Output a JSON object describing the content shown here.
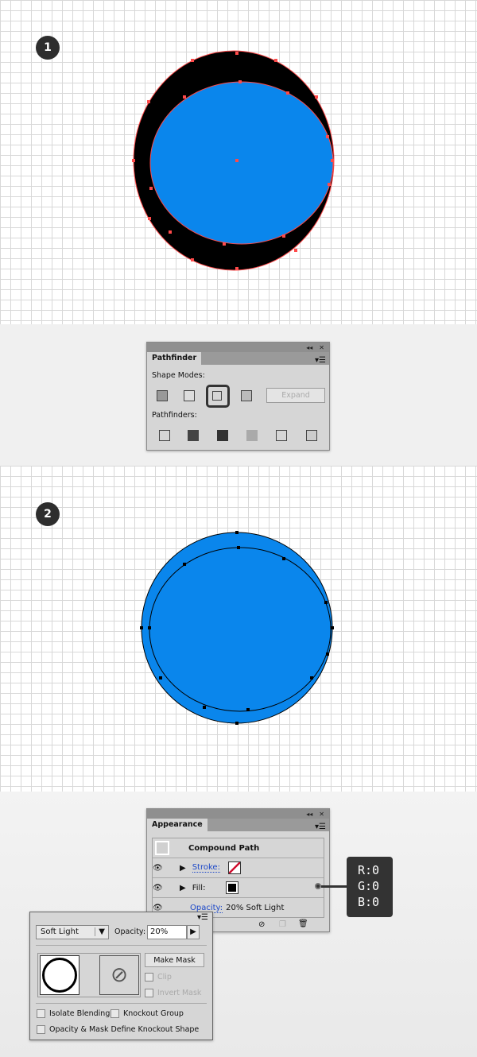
{
  "steps": [
    "1",
    "2"
  ],
  "colors": {
    "fill_blue": "#0a86ec",
    "anchor_red": "#ff4a4a",
    "panel_bg": "#d6d6d6"
  },
  "pathfinder": {
    "title": "Pathfinder",
    "shape_modes_label": "Shape Modes:",
    "expand_label": "Expand",
    "pathfinders_label": "Pathfinders:",
    "shape_mode_icons": [
      "unite-icon",
      "minus-front-icon",
      "intersect-icon",
      "exclude-icon"
    ],
    "selected_shape_mode": "intersect",
    "pathfinder_icons": [
      "divide-icon",
      "trim-icon",
      "merge-icon",
      "crop-icon",
      "outline-icon",
      "minus-back-icon"
    ]
  },
  "appearance": {
    "title": "Appearance",
    "object_label": "Compound Path",
    "stroke_label": "Stroke:",
    "fill_label": "Fill:",
    "opacity_label": "Opacity:",
    "opacity_value": "20% Soft Light"
  },
  "callout": {
    "r": "R:0",
    "g": "G:0",
    "b": "B:0"
  },
  "transparency": {
    "blend_mode": "Soft Light",
    "opacity_label": "Opacity:",
    "opacity_value": "20%",
    "make_mask": "Make Mask",
    "clip": "Clip",
    "invert_mask": "Invert Mask",
    "isolate_blending": "Isolate Blending",
    "knockout_group": "Knockout Group",
    "opacity_mask_knockout": "Opacity & Mask Define Knockout Shape"
  }
}
